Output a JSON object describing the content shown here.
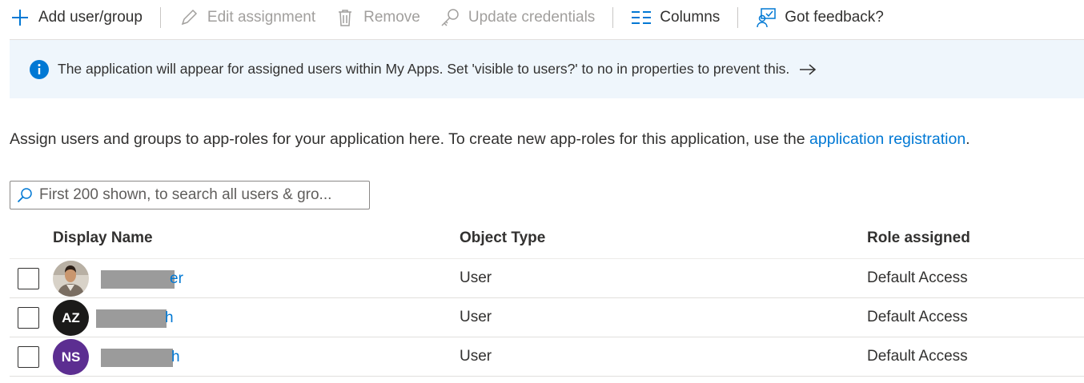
{
  "toolbar": {
    "add": "Add user/group",
    "edit": "Edit assignment",
    "remove": "Remove",
    "update": "Update credentials",
    "columns": "Columns",
    "feedback": "Got feedback?"
  },
  "info": {
    "message": "The application will appear for assigned users within My Apps. Set 'visible to users?' to no in properties to prevent this."
  },
  "description": {
    "text": "Assign users and groups to app-roles for your application here. To create new app-roles for this application, use the ",
    "link": "application registration",
    "suffix": "."
  },
  "search": {
    "placeholder": "First 200 shown, to search all users & gro..."
  },
  "table": {
    "headers": [
      "Display Name",
      "Object Type",
      "Role assigned"
    ],
    "rows": [
      {
        "initials": "",
        "name_visible": "er",
        "type": "User",
        "role": "Default Access"
      },
      {
        "initials": "AZ",
        "name_visible": "h",
        "type": "User",
        "role": "Default Access"
      },
      {
        "initials": "NS",
        "name_visible": "h",
        "type": "User",
        "role": "Default Access"
      }
    ]
  },
  "colors": {
    "accent": "#0078d4",
    "info_bg": "#eff6fc",
    "avatar_az": "#1b1a19",
    "avatar_ns": "#5c2e91"
  }
}
